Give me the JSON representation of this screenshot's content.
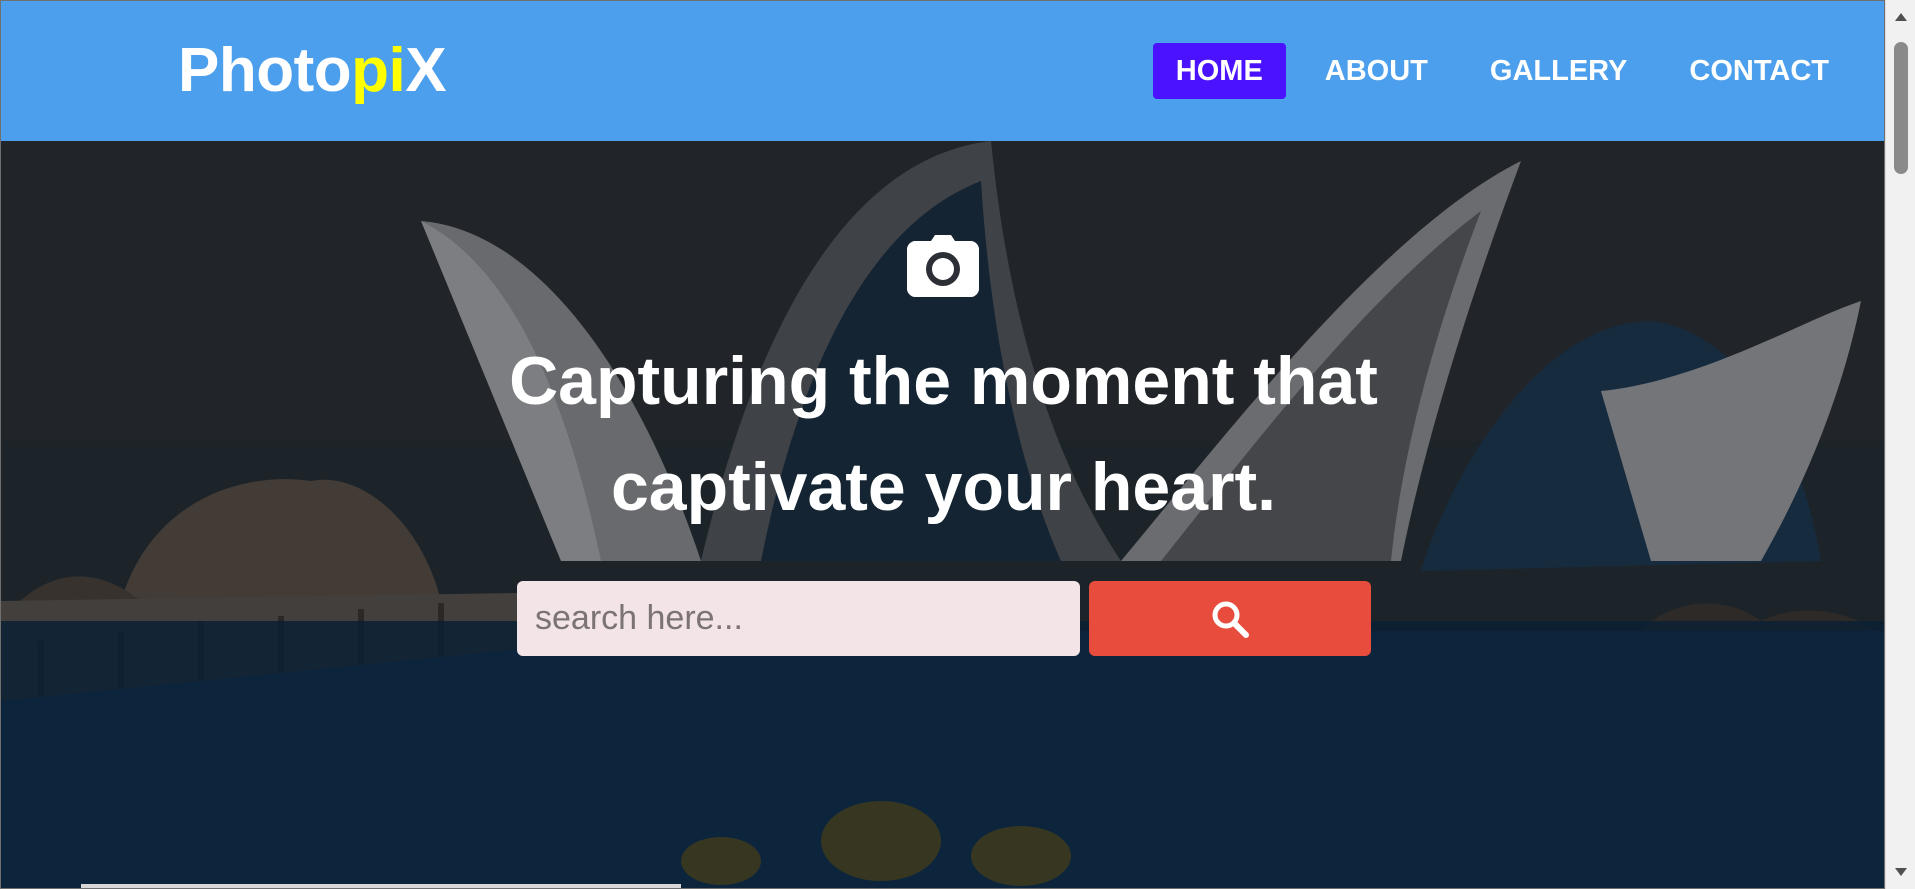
{
  "brand": {
    "logo_part1": "Photo",
    "logo_accent": "pi",
    "logo_part2": "X"
  },
  "nav": {
    "items": [
      {
        "label": "HOME",
        "active": true
      },
      {
        "label": "ABOUT",
        "active": false
      },
      {
        "label": "GALLERY",
        "active": false
      },
      {
        "label": "CONTACT",
        "active": false
      }
    ]
  },
  "hero": {
    "icon": "camera-icon",
    "headline_line1": "Capturing the moment that",
    "headline_line2": "captivate your heart.",
    "search": {
      "placeholder": "search here...",
      "value": "",
      "button_icon": "search-icon"
    }
  },
  "colors": {
    "header_bg": "#4b9fec",
    "nav_active_bg": "#4a12ff",
    "logo_accent": "#ffff00",
    "search_button_bg": "#e84c3d",
    "search_input_bg": "#f3e5e7"
  }
}
